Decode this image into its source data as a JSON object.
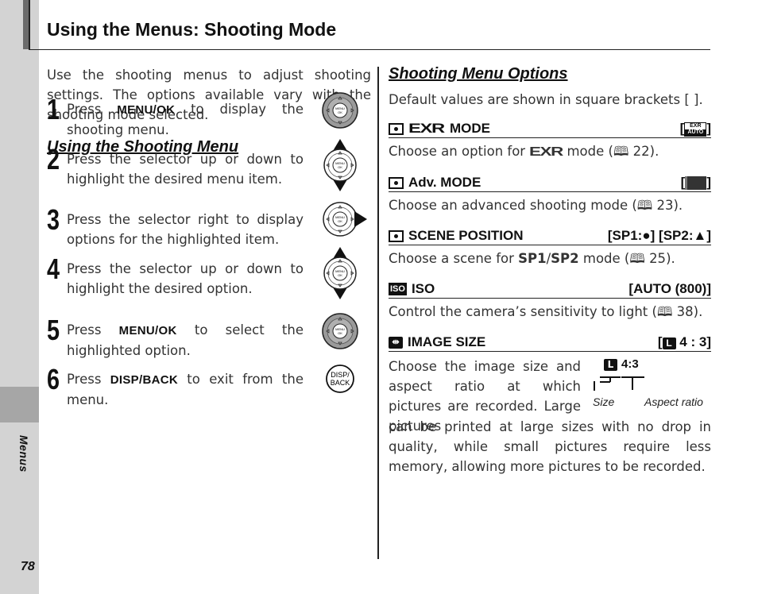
{
  "page": {
    "title": "Using the Menus: Shooting Mode",
    "section_tab": "Menus",
    "page_number": "78"
  },
  "left_column": {
    "intro": "Use the shooting menus to adjust shooting settings. The options available vary with the shooting mode selected.",
    "heading": "Using the Shooting Menu",
    "steps": [
      {
        "number": "1",
        "pre": "Press ",
        "bold": "MENU/OK",
        "post": " to display the shooting menu.",
        "icon": "selector-menu-ok-icon"
      },
      {
        "number": "2",
        "pre": "Press the selector up or down to highlight the desired menu item.",
        "bold": "",
        "post": "",
        "icon": "selector-up-down-icon"
      },
      {
        "number": "3",
        "pre": "Press the selector right to display options for the highlighted item.",
        "bold": "",
        "post": "",
        "icon": "selector-right-icon"
      },
      {
        "number": "4",
        "pre": "Press the selector up or down to highlight the desired option.",
        "bold": "",
        "post": "",
        "icon": "selector-up-down-icon"
      },
      {
        "number": "5",
        "pre": "Press ",
        "bold": "MENU/OK",
        "post": " to select the highlighted option.",
        "icon": "selector-menu-ok-icon"
      },
      {
        "number": "6",
        "pre": "Press ",
        "bold": "DISP/BACK",
        "post": " to exit from the menu.",
        "icon": "disp-back-icon"
      }
    ],
    "button_labels": {
      "menu_ok_line1": "MENU",
      "menu_ok_line2": "OK",
      "disp": "DISP/",
      "back": "BACK"
    }
  },
  "right_column": {
    "heading": "Shooting Menu Options",
    "note": "Default values are shown in square brackets [ ].",
    "options": [
      {
        "icon": "camera-icon",
        "name": "MODE",
        "prefix_logo": "EXR",
        "default": "EXR AUTO",
        "desc_pre": "Choose an option for ",
        "desc_logo": "EXR",
        "desc_post": " mode (",
        "page_ref": "22",
        "desc_end": ")."
      },
      {
        "icon": "camera-icon",
        "name": "Adv. MODE",
        "default": "advanced-mode-icon",
        "desc_pre": "Choose an advanced shooting mode (",
        "page_ref": "23",
        "desc_end": ")."
      },
      {
        "icon": "camera-icon",
        "name": "SCENE POSITION",
        "default_sp1": "[SP1:",
        "default_sp2": "[SP2:",
        "desc_pre": "Choose a scene for ",
        "desc_bold1": "SP1",
        "desc_sep": "/",
        "desc_bold2": "SP2",
        "desc_post": " mode (",
        "page_ref": "25",
        "desc_end": ")."
      },
      {
        "icon": "iso-icon",
        "icon_text": "ISO",
        "name": "ISO",
        "default": "[AUTO (800)]",
        "desc_pre": "Control the camera’s sensitivity to light (",
        "page_ref": "38",
        "desc_end": ")."
      },
      {
        "icon": "image-size-icon",
        "name": "IMAGE SIZE",
        "default_size": "L",
        "default_ratio": "4 : 3",
        "desc_wrap": "Choose the image size and aspect ratio at which pictures are recorded. Large pictures",
        "desc_cont": "can be printed at large sizes with no drop in quality, while small pictures require less memory, allowing more pictures to be recorded."
      }
    ],
    "diagram": {
      "size_glyph": "L",
      "ratio": "4:3",
      "size_label": "Size",
      "ratio_label": "Aspect ratio"
    }
  }
}
